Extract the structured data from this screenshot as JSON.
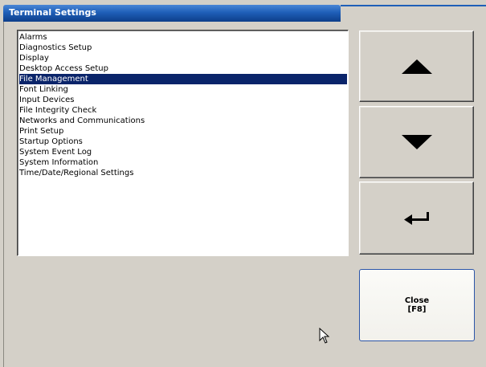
{
  "window": {
    "title": "Terminal Settings"
  },
  "list": {
    "items": [
      {
        "label": "Alarms",
        "selected": false
      },
      {
        "label": "Diagnostics Setup",
        "selected": false
      },
      {
        "label": "Display",
        "selected": false
      },
      {
        "label": "Desktop Access Setup",
        "selected": false
      },
      {
        "label": "File Management",
        "selected": true
      },
      {
        "label": "Font Linking",
        "selected": false
      },
      {
        "label": "Input Devices",
        "selected": false
      },
      {
        "label": "File Integrity Check",
        "selected": false
      },
      {
        "label": "Networks and Communications",
        "selected": false
      },
      {
        "label": "Print Setup",
        "selected": false
      },
      {
        "label": "Startup Options",
        "selected": false
      },
      {
        "label": "System Event Log",
        "selected": false
      },
      {
        "label": "System Information",
        "selected": false
      },
      {
        "label": "Time/Date/Regional Settings",
        "selected": false
      }
    ]
  },
  "buttons": {
    "up_icon": "up-arrow-icon",
    "down_icon": "down-arrow-icon",
    "enter_icon": "enter-arrow-icon",
    "close_line1": "Close",
    "close_line2": "[F8]"
  },
  "colors": {
    "titlebar": "#1f5fb8",
    "selection": "#0a246a",
    "face": "#d4d0c8"
  }
}
